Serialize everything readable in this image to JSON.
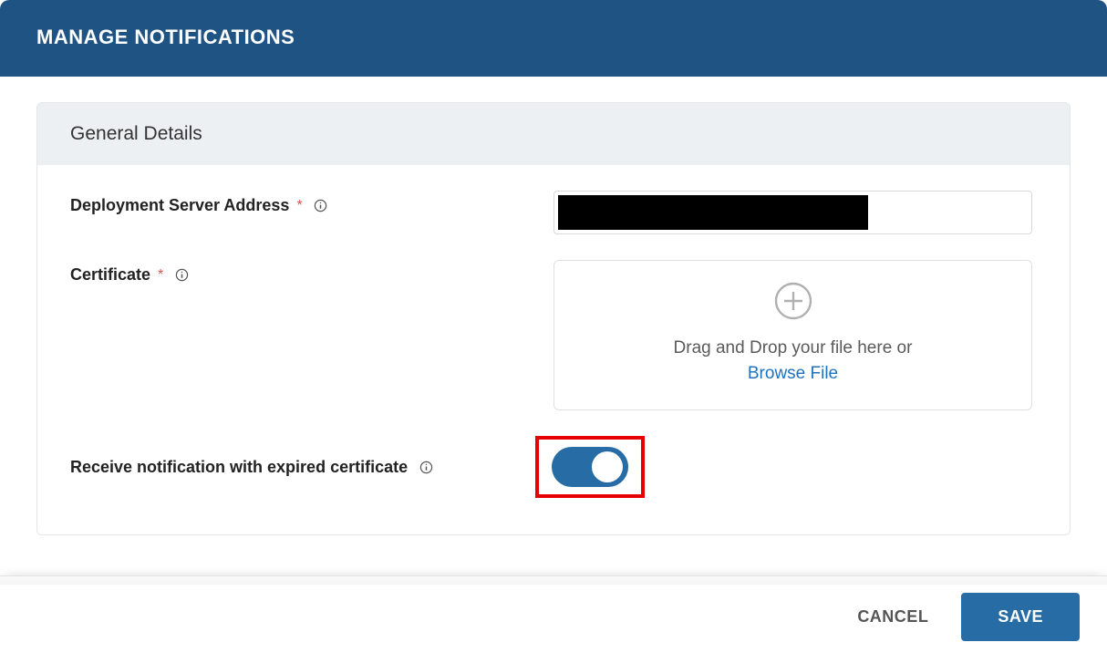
{
  "header": {
    "title": "MANAGE NOTIFICATIONS"
  },
  "panel": {
    "title": "General Details"
  },
  "fields": {
    "serverAddress": {
      "label": "Deployment Server Address",
      "value": ""
    },
    "certificate": {
      "label": "Certificate",
      "dropText": "Drag and Drop your file here or",
      "browseText": "Browse File"
    },
    "expiredNotify": {
      "label": "Receive notification with expired certificate",
      "enabled": true
    }
  },
  "footer": {
    "cancel": "CANCEL",
    "save": "SAVE"
  }
}
